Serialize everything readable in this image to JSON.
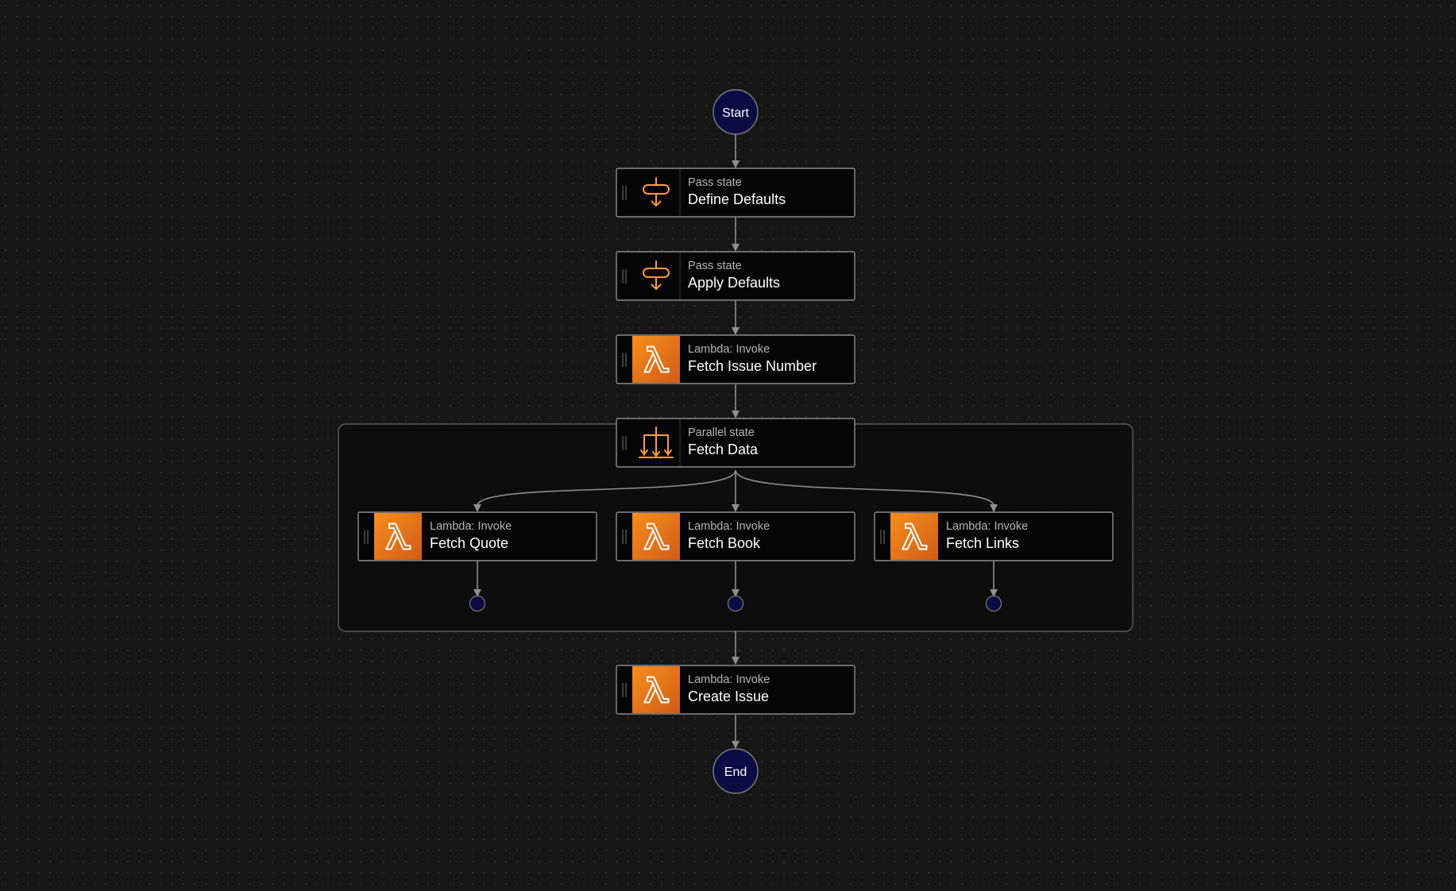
{
  "workflow": {
    "start": {
      "label": "Start"
    },
    "end": {
      "label": "End"
    },
    "states": [
      {
        "id": "define-defaults",
        "type_label": "Pass state",
        "name": "Define Defaults",
        "icon": "pass-state-icon"
      },
      {
        "id": "apply-defaults",
        "type_label": "Pass state",
        "name": "Apply Defaults",
        "icon": "pass-state-icon"
      },
      {
        "id": "fetch-issue-number",
        "type_label": "Lambda: Invoke",
        "name": "Fetch Issue Number",
        "icon": "lambda-icon"
      },
      {
        "id": "fetch-data",
        "type_label": "Parallel state",
        "name": "Fetch Data",
        "icon": "parallel-state-icon"
      },
      {
        "id": "fetch-quote",
        "type_label": "Lambda: Invoke",
        "name": "Fetch Quote",
        "icon": "lambda-icon"
      },
      {
        "id": "fetch-book",
        "type_label": "Lambda: Invoke",
        "name": "Fetch Book",
        "icon": "lambda-icon"
      },
      {
        "id": "fetch-links",
        "type_label": "Lambda: Invoke",
        "name": "Fetch Links",
        "icon": "lambda-icon"
      },
      {
        "id": "create-issue",
        "type_label": "Lambda: Invoke",
        "name": "Create Issue",
        "icon": "lambda-icon"
      }
    ]
  },
  "colors": {
    "background": "#161616",
    "terminal_fill": "#0b0c44",
    "accent_orange": "#ff9a3e",
    "lambda_gradient_top": "#f78e1e",
    "lambda_gradient_bottom": "#d05c17",
    "connector": "#8f8f8f"
  }
}
